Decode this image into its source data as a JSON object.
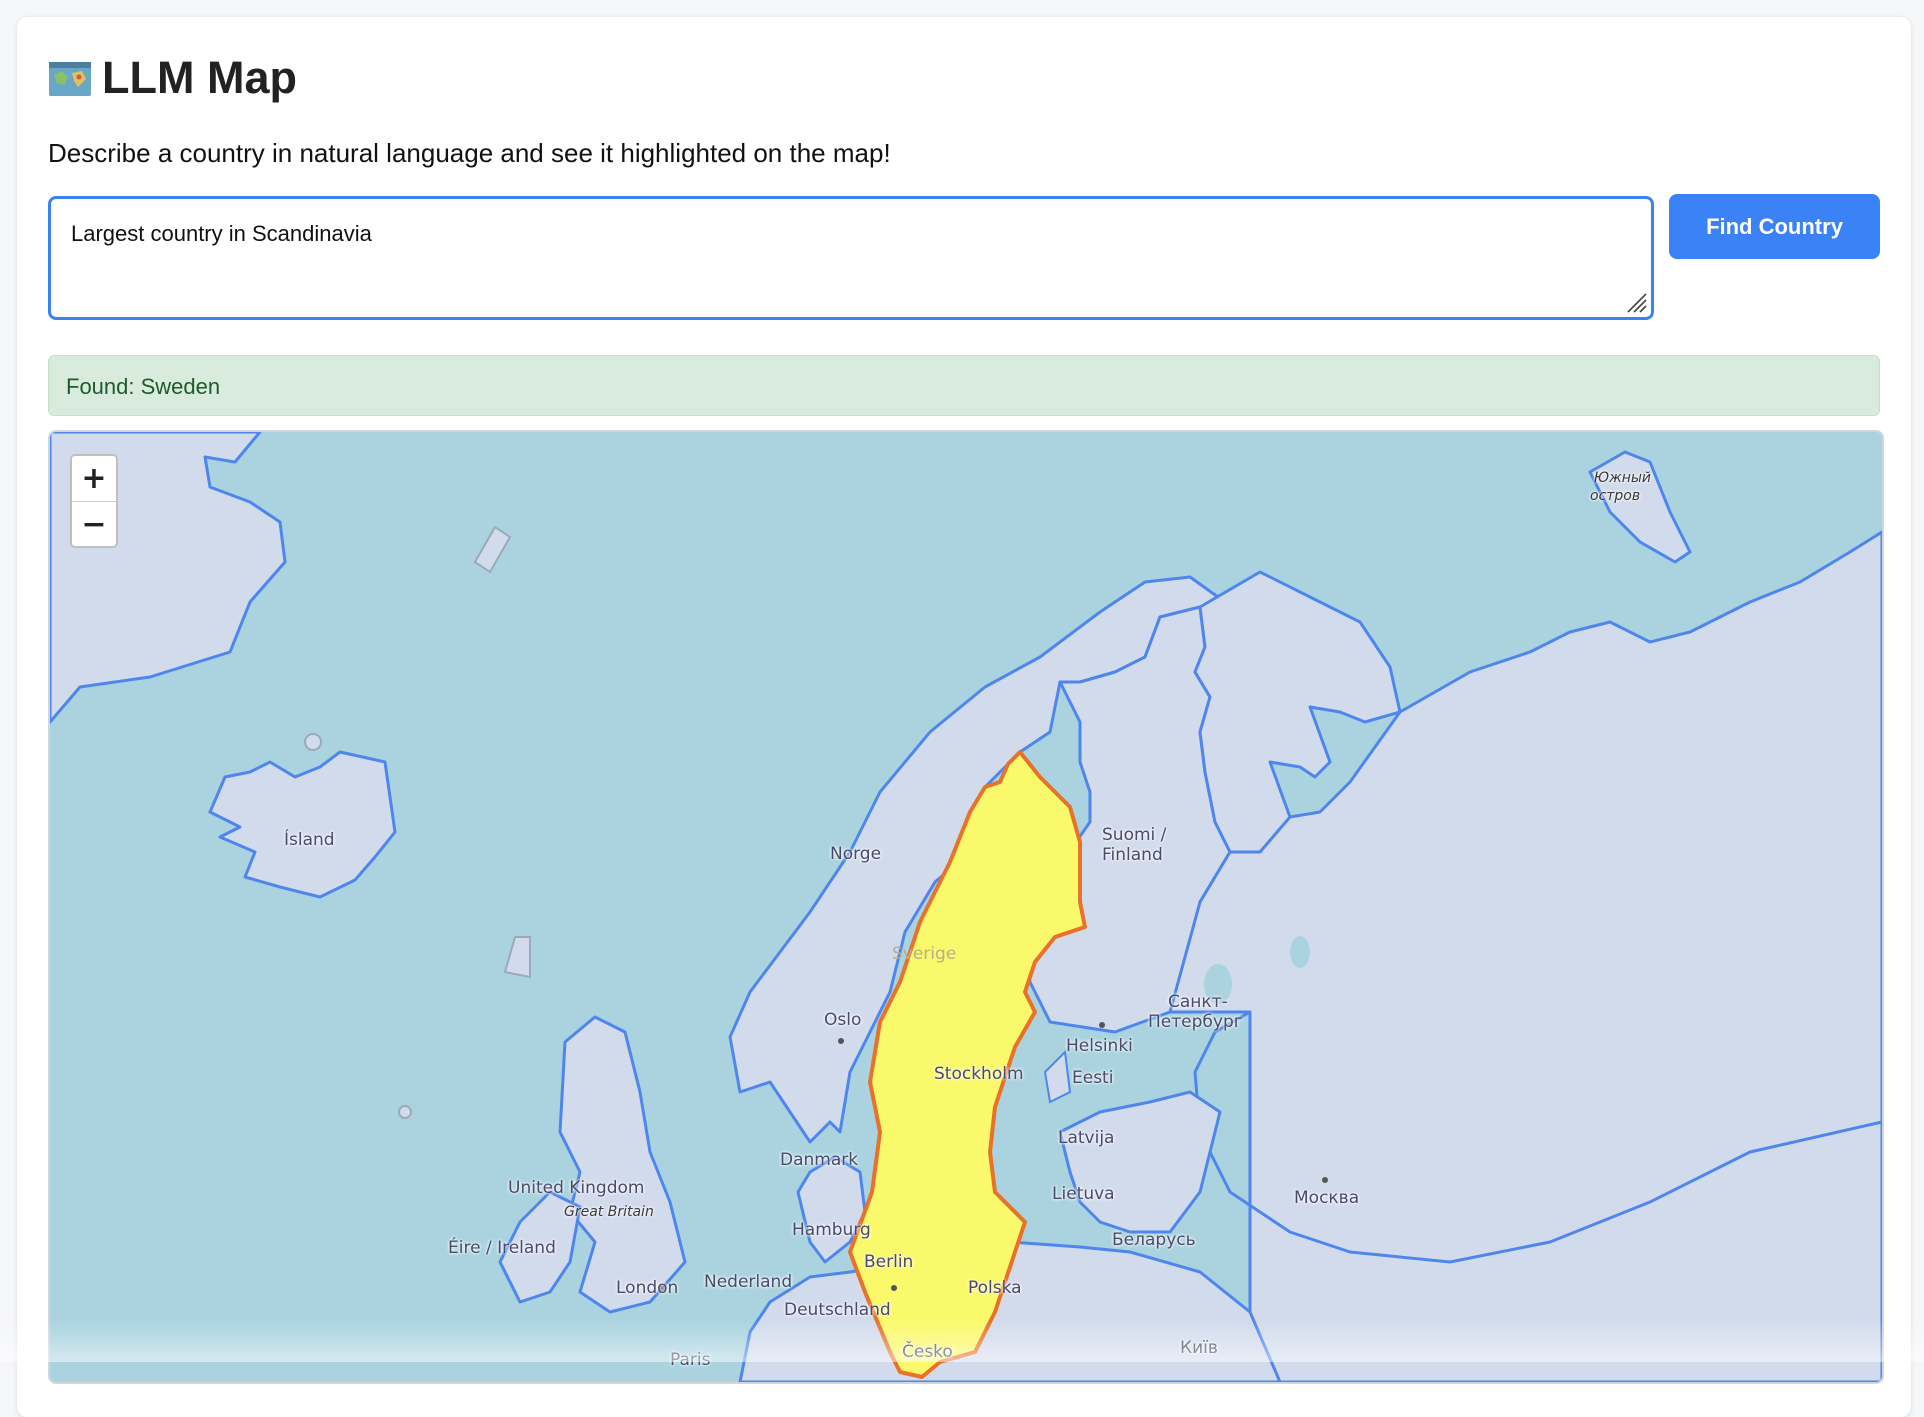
{
  "app": {
    "title": "LLM Map",
    "subtitle": "Describe a country in natural language and see it highlighted on the map!"
  },
  "query": {
    "value": "Largest country in Scandinavia"
  },
  "actions": {
    "find_label": "Find Country"
  },
  "status": {
    "text": "Found: Sweden",
    "color": "#d9ebdd"
  },
  "map": {
    "zoom_in": "+",
    "zoom_out": "−",
    "highlight_color": "#faf96b",
    "highlight_border": "#e8722a",
    "border_color": "#4f86ee",
    "water_color": "#aad3df",
    "labels": {
      "island": "Ísland",
      "norge": "Norge",
      "suomi": "Suomi /",
      "finland": "Finland",
      "sverige": "Sverige",
      "oslo": "Oslo",
      "stockholm": "Stockholm",
      "helsinki": "Helsinki",
      "spb1": "Санкт-",
      "spb2": "Петербург",
      "eesti": "Eesti",
      "latvija": "Latvija",
      "lietuva": "Lietuva",
      "moskva": "Москва",
      "belarus": "Беларусь",
      "danmark": "Danmark",
      "uk": "United Kingdom",
      "gb": "Great Britain",
      "ireland": "Éire / Ireland",
      "london": "London",
      "hamburg": "Hamburg",
      "berlin": "Berlin",
      "nederland": "Nederland",
      "deutschland": "Deutschland",
      "polska": "Polska",
      "cesko": "Česko",
      "paris": "Paris",
      "kyiv": "Київ",
      "yuzhny1": "Южный",
      "yuzhny2": "остров"
    }
  }
}
